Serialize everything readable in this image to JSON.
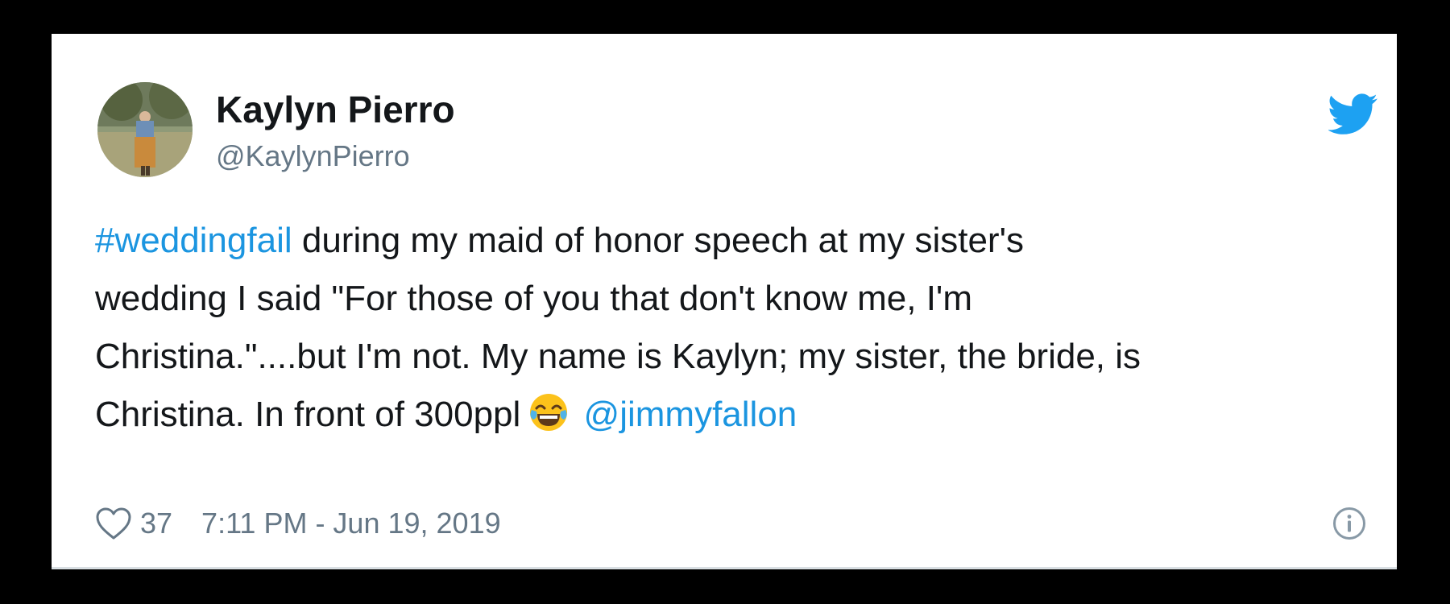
{
  "tweet": {
    "author": {
      "display_name": "Kaylyn Pierro",
      "handle": "@KaylynPierro",
      "avatar": "profile-photo"
    },
    "body": {
      "line1_hashtag": "#weddingfail",
      "line1_rest": " during my maid of honor speech at my sister's",
      "line2": "wedding I said \"For those of you that don't know me, I'm",
      "line3": "Christina.\"....but I'm not. My name is Kaylyn; my sister, the bride, is",
      "line4_text": "Christina. In front of 300ppl",
      "line4_emoji": "face-with-tears-of-joy",
      "line4_mention": "@jimmyfallon"
    },
    "likes": "37",
    "timestamp": "7:11 PM - Jun 19, 2019"
  },
  "icons": {
    "brand": "twitter-bird-icon",
    "like": "heart-icon",
    "info": "info-icon"
  },
  "colors": {
    "background": "#000000",
    "card": "#ffffff",
    "link": "#1b95e0",
    "brand": "#1da1f2",
    "secondary_text": "#657786"
  }
}
